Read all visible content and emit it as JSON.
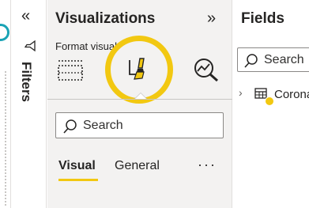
{
  "filters": {
    "label": "Filters",
    "collapse_glyph": "«",
    "icon": "funnel-icon"
  },
  "visualizations": {
    "title": "Visualizations",
    "collapse_glyph": "»",
    "format_label": "Format visual",
    "buttons": [
      {
        "icon": "build-visual-icon"
      },
      {
        "icon": "format-paintbrush-icon",
        "selected": true
      },
      {
        "icon": "analytics-magnifier-icon"
      }
    ],
    "search_placeholder": "Search",
    "tabs": [
      {
        "label": "Visual",
        "active": true
      },
      {
        "label": "General",
        "active": false
      }
    ],
    "more_glyph": "···"
  },
  "fields": {
    "title": "Fields",
    "search_placeholder": "Search",
    "tables": [
      {
        "name": "Corona",
        "icon": "table-icon",
        "expand_glyph": "›"
      }
    ]
  },
  "colors": {
    "highlight": "#f2c811",
    "pane_bg": "#f3f2f1",
    "text": "#252423"
  }
}
